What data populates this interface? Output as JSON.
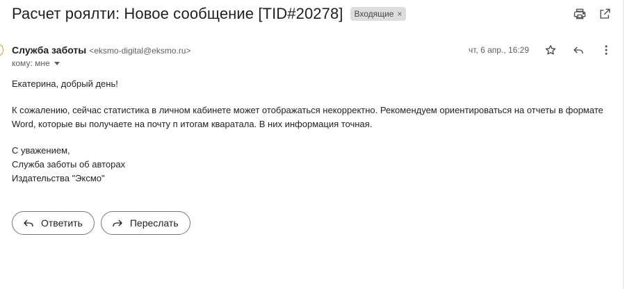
{
  "email": {
    "subject": "Расчет роялти: Новое сообщение [TID#20278]",
    "label": "Входящие",
    "label_remove": "×",
    "sender_name": "Служба заботы",
    "sender_email": "<eksmo-digital@eksmo.ru>",
    "recipient": "кому: мне",
    "date": "чт, 6 апр., 16:29",
    "body": {
      "greeting": "Екатерина, добрый день!",
      "paragraph_line_1": "К сожалению, сейчас статистика в личном кабинете может отображаться некорректно. Рекомендуем ориентироваться на отчеты в формате",
      "paragraph_line_2": "Word, которые вы получаете на почту п итогам кваратала. В них информация точная.",
      "signature_line_1": "С уважением,",
      "signature_line_2": "Служба заботы об авторах",
      "signature_line_3": "Издательства \"Эксмо\""
    }
  },
  "actions": {
    "reply_label": "Ответить",
    "forward_label": "Переслать"
  },
  "icons": {
    "print": "print-icon",
    "open_new_window": "open-in-new-window-icon",
    "star": "star-icon",
    "reply": "reply-icon",
    "more": "more-vertical-icon",
    "forward": "forward-icon"
  },
  "colors": {
    "text": "#1f1f1f",
    "muted": "#5e5e5e",
    "label_bg": "#dddddd",
    "button_border": "#747775"
  }
}
